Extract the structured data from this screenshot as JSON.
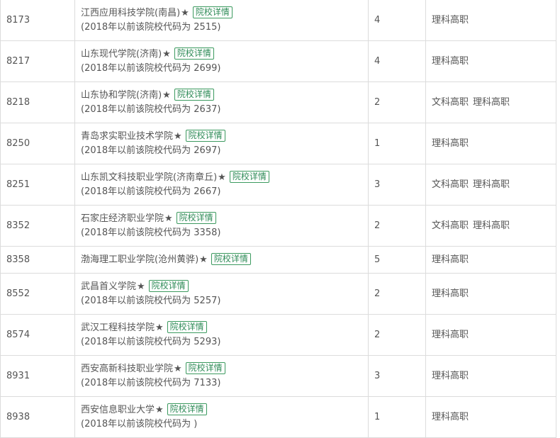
{
  "detail_label": "院校详情",
  "star": "★",
  "rows": [
    {
      "code": "8173",
      "name": "江西应用科技学院(南昌)",
      "old_code": "(2018年以前该院校代码为 2515)",
      "count": "4",
      "types": [
        "理科高职"
      ]
    },
    {
      "code": "8217",
      "name": "山东现代学院(济南)",
      "old_code": "(2018年以前该院校代码为 2699)",
      "count": "4",
      "types": [
        "理科高职"
      ]
    },
    {
      "code": "8218",
      "name": "山东协和学院(济南)",
      "old_code": "(2018年以前该院校代码为 2637)",
      "count": "2",
      "types": [
        "文科高职",
        "理科高职"
      ]
    },
    {
      "code": "8250",
      "name": "青岛求实职业技术学院",
      "old_code": "(2018年以前该院校代码为 2697)",
      "count": "1",
      "types": [
        "理科高职"
      ]
    },
    {
      "code": "8251",
      "name": "山东凯文科技职业学院(济南章丘)",
      "old_code": "(2018年以前该院校代码为 2667)",
      "count": "3",
      "types": [
        "文科高职",
        "理科高职"
      ]
    },
    {
      "code": "8352",
      "name": "石家庄经济职业学院",
      "old_code": "(2018年以前该院校代码为 3358)",
      "count": "2",
      "types": [
        "文科高职",
        "理科高职"
      ]
    },
    {
      "code": "8358",
      "name": "渤海理工职业学院(沧州黄骅)",
      "old_code": "",
      "count": "5",
      "types": [
        "理科高职"
      ]
    },
    {
      "code": "8552",
      "name": "武昌首义学院",
      "old_code": "(2018年以前该院校代码为 5257)",
      "count": "2",
      "types": [
        "理科高职"
      ]
    },
    {
      "code": "8574",
      "name": "武汉工程科技学院",
      "old_code": "(2018年以前该院校代码为 5293)",
      "count": "2",
      "types": [
        "理科高职"
      ]
    },
    {
      "code": "8931",
      "name": "西安高新科技职业学院",
      "old_code": "(2018年以前该院校代码为 7133)",
      "count": "3",
      "types": [
        "理科高职"
      ]
    },
    {
      "code": "8938",
      "name": "西安信息职业大学",
      "old_code": "(2018年以前该院校代码为 )",
      "count": "1",
      "types": [
        "理科高职"
      ]
    }
  ]
}
